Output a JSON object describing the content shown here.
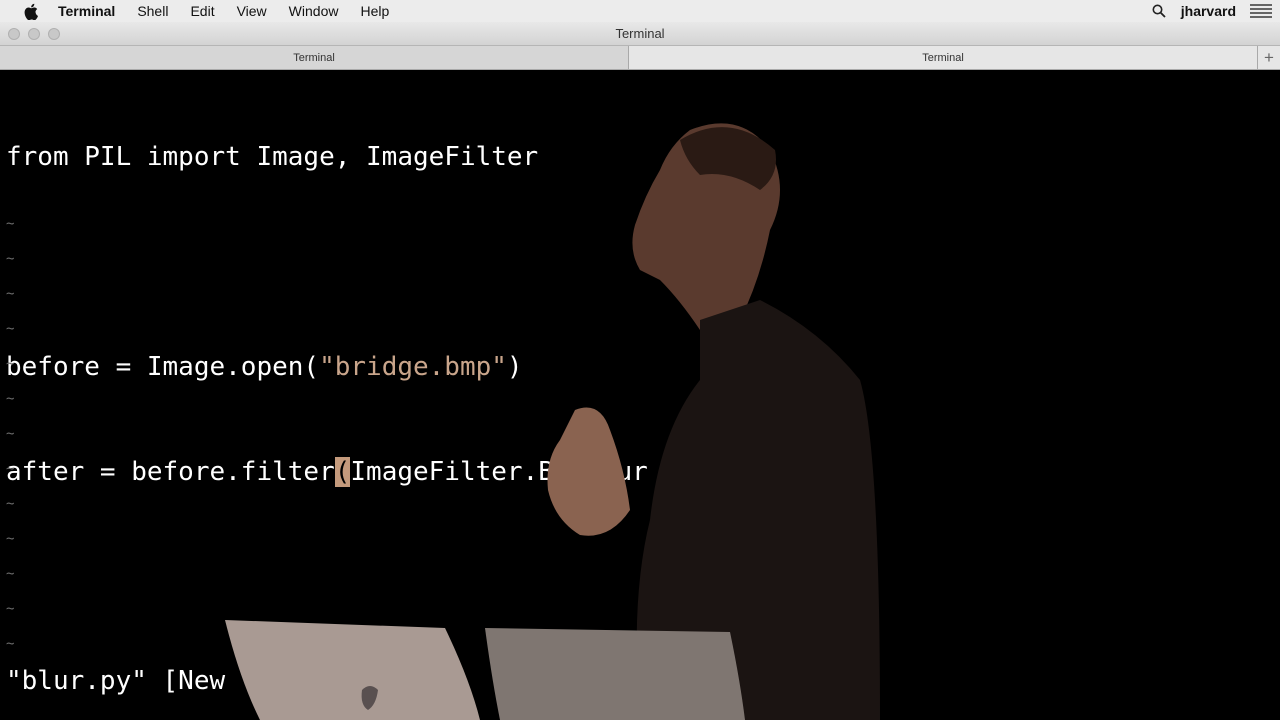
{
  "menubar": {
    "app_name": "Terminal",
    "items": [
      "Shell",
      "Edit",
      "View",
      "Window",
      "Help"
    ],
    "user": "jharvard"
  },
  "window": {
    "title": "Terminal"
  },
  "tabs": [
    {
      "label": "Terminal",
      "active": true
    },
    {
      "label": "Terminal",
      "active": false
    }
  ],
  "editor": {
    "lines": {
      "line1": "from PIL import Image, ImageFilter",
      "line2": "",
      "line3_before": "before = Image.open(",
      "line3_string": "\"bridge.bmp\"",
      "line3_after": ")",
      "line4_before": "after = before.filter",
      "line4_cursor": "(",
      "line4_after": "ImageFilter.BoxBlur"
    },
    "tilde": "~",
    "status": "\"blur.py\" [New "
  },
  "colors": {
    "string": "#c9a58b",
    "cursor": "#c49a7c",
    "tilde": "#6b6b6b"
  }
}
